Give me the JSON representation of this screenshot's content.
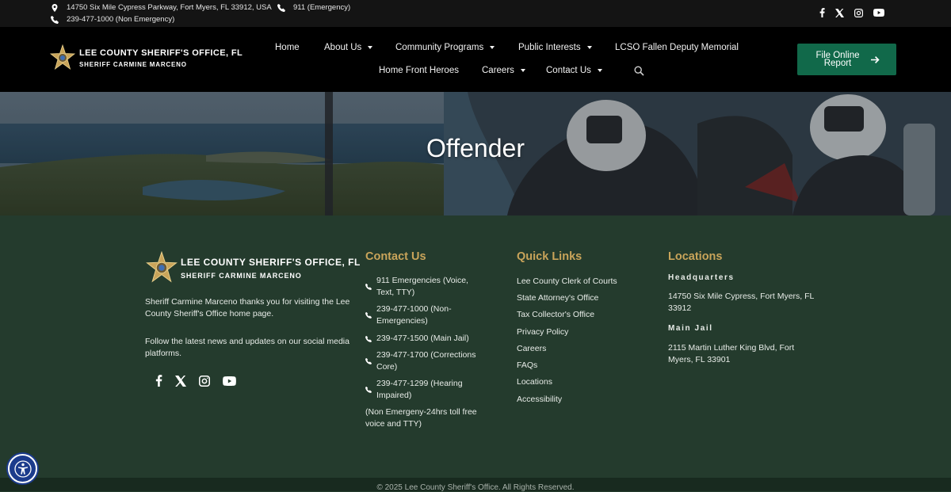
{
  "topbar": {
    "address": "14750 Six Mile Cypress Parkway, Fort Myers, FL 33912, USA",
    "emergency": "911 (Emergency)",
    "non_emergency": "239-477-1000 (Non Emergency)",
    "social_icons": [
      "facebook-icon",
      "x-icon",
      "instagram-icon",
      "youtube-icon"
    ]
  },
  "header": {
    "logo_title": "LEE COUNTY SHERIFF'S OFFICE, FL",
    "logo_subtitle": "SHERIFF CARMINE MARCENO",
    "nav": {
      "home": "Home",
      "about": "About Us",
      "community": "Community Programs",
      "public": "Public Interests",
      "memorial": "LCSO Fallen Deputy Memorial",
      "heroes": "Home Front Heroes",
      "careers": "Careers",
      "contact": "Contact Us"
    },
    "cta_label": "File Online Report"
  },
  "hero": {
    "title": "Offender"
  },
  "footer": {
    "logo_title": "LEE COUNTY SHERIFF'S OFFICE, FL",
    "logo_subtitle": "SHERIFF CARMINE MARCENO",
    "intro": "Sheriff Carmine Marceno thanks you for visiting the Lee County Sheriff's Office home page.",
    "follow": "Follow the latest news and updates on our social media platforms.",
    "contact": {
      "heading": "Contact Us",
      "items": [
        "911 Emergencies (Voice, Text, TTY)",
        "239-477-1000 (Non-Emergencies)",
        "239-477-1500 (Main Jail)",
        "239-477-1700 (Corrections Core)",
        "239-477-1299 (Hearing Impaired)"
      ],
      "note": "(Non Emergeny-24hrs toll free voice and TTY)"
    },
    "quick_links": {
      "heading": "Quick Links",
      "items": [
        "Lee County Clerk of Courts",
        "State Attorney's Office",
        "Tax Collector's Office",
        "Privacy Policy",
        "Careers",
        "FAQs",
        "Locations",
        "Accessibility"
      ]
    },
    "locations": {
      "heading": "Locations",
      "hq_label": "Headquarters",
      "hq_address": "14750 Six Mile Cypress, Fort Myers, FL 33912",
      "jail_label": "Main Jail",
      "jail_address": "2115 Martin Luther King Blvd, Fort Myers, FL 33901"
    },
    "copyright": "© 2025 Lee County Sheriff's Office. All Rights Reserved."
  },
  "colors": {
    "accent_gold": "#c9a45a",
    "cta_green": "#11694a",
    "footer_bg": "#243b2d"
  }
}
